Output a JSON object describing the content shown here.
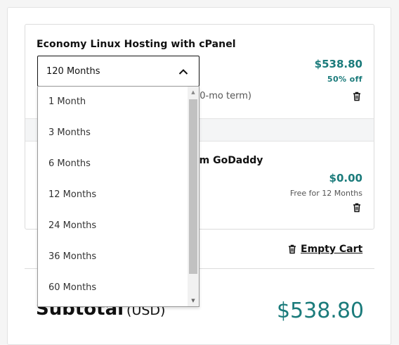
{
  "cart": {
    "item1": {
      "title": "Economy Linux Hosting with cPanel",
      "price": "$538.80",
      "discount": "50% off",
      "term_fragment": "20-mo term)"
    },
    "item2": {
      "title_fragment": "om GoDaddy",
      "price": "$0.00",
      "note": "Free for 12 Months"
    },
    "empty_cart_label": "Empty Cart",
    "subtotal_label": "Subtotal",
    "subtotal_currency": "(USD)",
    "subtotal_value": "$538.80"
  },
  "term_select": {
    "selected": "120 Months",
    "options": [
      "1 Month",
      "3 Months",
      "6 Months",
      "12 Months",
      "24 Months",
      "36 Months",
      "60 Months"
    ]
  },
  "colors": {
    "accent": "#1b7b7b",
    "text": "#111111"
  }
}
